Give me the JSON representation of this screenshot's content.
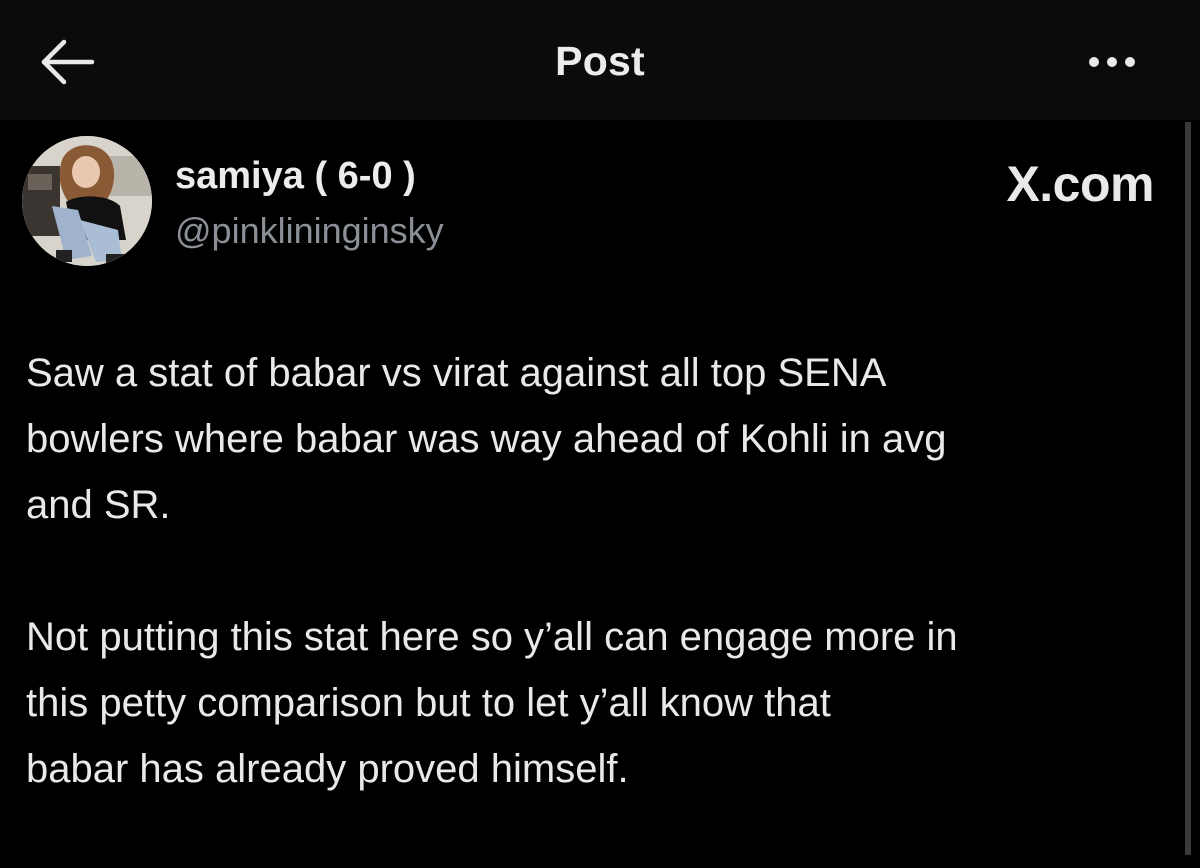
{
  "header": {
    "title": "Post",
    "back_icon": "arrow-left-icon",
    "more_icon": "more-horizontal-icon"
  },
  "author": {
    "display_name": "samiya ( 6-0 )",
    "handle": "@pinklininginsky",
    "avatar_icon": "user-avatar"
  },
  "watermark": "X.com",
  "post": {
    "paragraph_1": {
      "lines": [
        "Saw a stat of babar vs virat against all top SENA",
        "bowlers where babar was way ahead of Kohli in avg",
        "and SR."
      ]
    },
    "paragraph_2": {
      "lines": [
        "Not putting this stat here so y’all can engage more in",
        "this petty comparison but to let y’all know that",
        "babar has already proved himself."
      ]
    }
  },
  "colors": {
    "background": "#000000",
    "header_background": "#0b0b0b",
    "text_primary": "#e7e9ea",
    "text_secondary": "#8b9096"
  }
}
